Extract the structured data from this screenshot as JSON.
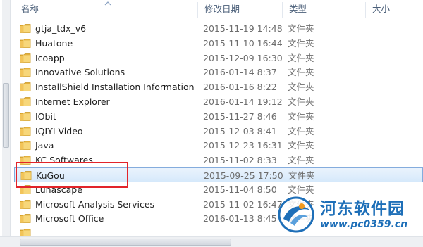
{
  "header": {
    "name": "名称",
    "date_modified": "修改日期",
    "type": "类型",
    "size": "大小"
  },
  "rows": [
    {
      "name": "gtja_tdx_v6",
      "date": "2015-11-19 14:48",
      "type": "文件夹",
      "icon": "folder-icon"
    },
    {
      "name": "Huatone",
      "date": "2015-11-10 16:44",
      "type": "文件夹",
      "icon": "folder-icon"
    },
    {
      "name": "Icoapp",
      "date": "2015-12-09 16:30",
      "type": "文件夹",
      "icon": "folder-icon"
    },
    {
      "name": "Innovative Solutions",
      "date": "2016-01-14 8:37",
      "type": "文件夹",
      "icon": "folder-icon"
    },
    {
      "name": "InstallShield Installation Information",
      "date": "2016-01-16 8:22",
      "type": "文件夹",
      "icon": "folder-icon"
    },
    {
      "name": "Internet Explorer",
      "date": "2016-01-14 19:12",
      "type": "文件夹",
      "icon": "folder-icon"
    },
    {
      "name": "IObit",
      "date": "2015-11-27 8:46",
      "type": "文件夹",
      "icon": "folder-icon"
    },
    {
      "name": "IQIYI Video",
      "date": "2015-12-03 8:41",
      "type": "文件夹",
      "icon": "folder-icon"
    },
    {
      "name": "Java",
      "date": "2015-12-23 16:31",
      "type": "文件夹",
      "icon": "folder-icon"
    },
    {
      "name": "KC Softwares",
      "date": "2015-11-02 8:33",
      "type": "文件夹",
      "icon": "folder-icon"
    },
    {
      "name": "KuGou",
      "date": "2015-09-25 17:50",
      "type": "文件夹",
      "icon": "folder-icon",
      "selected": true
    },
    {
      "name": "Lunascape",
      "date": "2015-11-04 8:50",
      "type": "文件夹",
      "icon": "folder-icon"
    },
    {
      "name": "Microsoft Analysis Services",
      "date": "2015-11-02 16:47",
      "type": "文件夹",
      "icon": "folder-icon"
    },
    {
      "name": "Microsoft Office",
      "date": "2016-01-13 8:45",
      "type": "文件夹",
      "icon": "folder-icon"
    },
    {
      "name": "",
      "date": "",
      "type": "",
      "icon": "folder-icon"
    }
  ],
  "watermark": {
    "title": "河东软件园",
    "url": "www.pc0359.cn"
  },
  "colors": {
    "highlight": "#e2242a",
    "selection": "#d6e9fb",
    "folder": "#f2c45a"
  }
}
